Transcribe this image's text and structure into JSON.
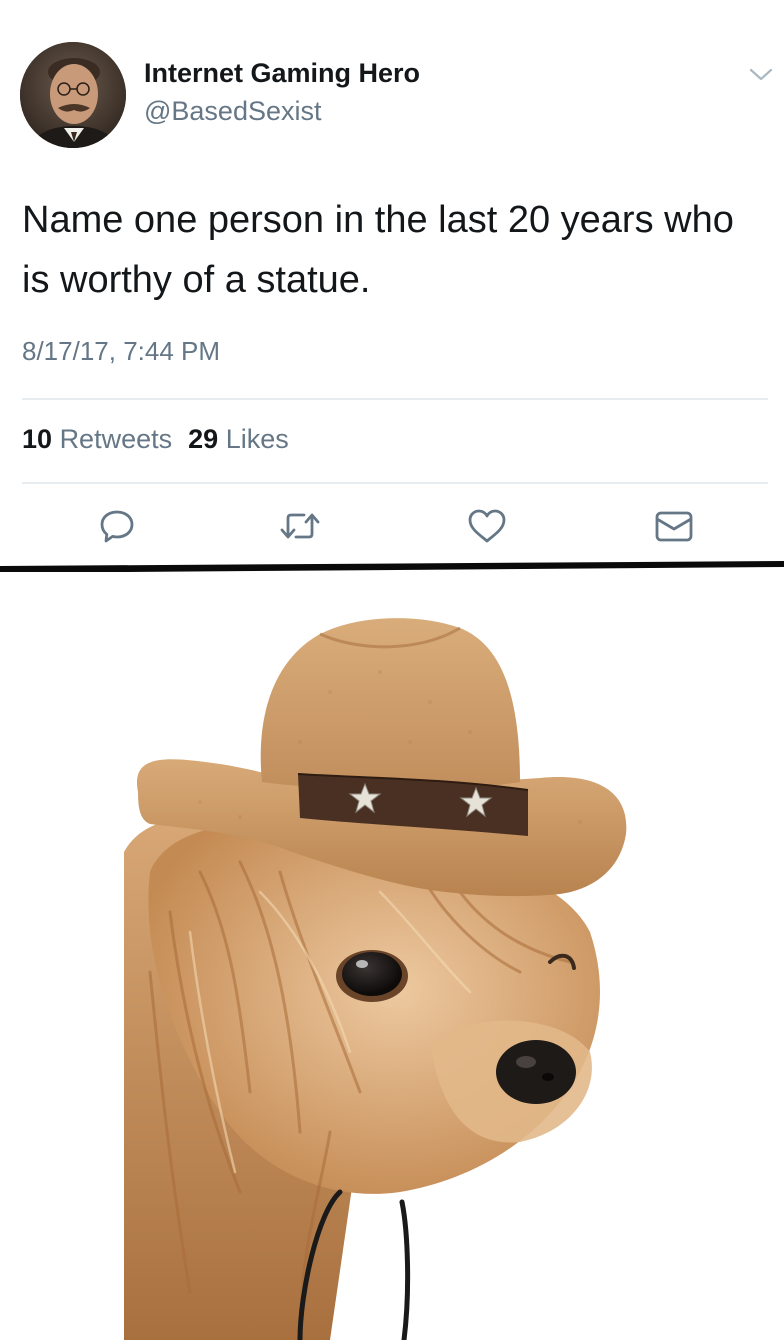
{
  "tweet": {
    "author": {
      "display_name": "Internet Gaming Hero",
      "handle": "@BasedSexist",
      "avatar_icon": "portrait-avatar"
    },
    "text": "Name one person in the last 20 years who is worthy of a statue.",
    "timestamp": "8/17/17, 7:44 PM",
    "stats": {
      "retweets_count": "10",
      "retweets_label": "Retweets",
      "likes_count": "29",
      "likes_label": "Likes"
    },
    "actions": [
      {
        "icon": "reply-icon"
      },
      {
        "icon": "retweet-icon"
      },
      {
        "icon": "like-icon"
      },
      {
        "icon": "direct-message-icon"
      }
    ],
    "accent_colors": {
      "primary_text": "#14171a",
      "secondary_text": "#657786",
      "divider": "#e6ecf0"
    }
  },
  "image": {
    "subject": "dog-in-cowboy-hat"
  }
}
